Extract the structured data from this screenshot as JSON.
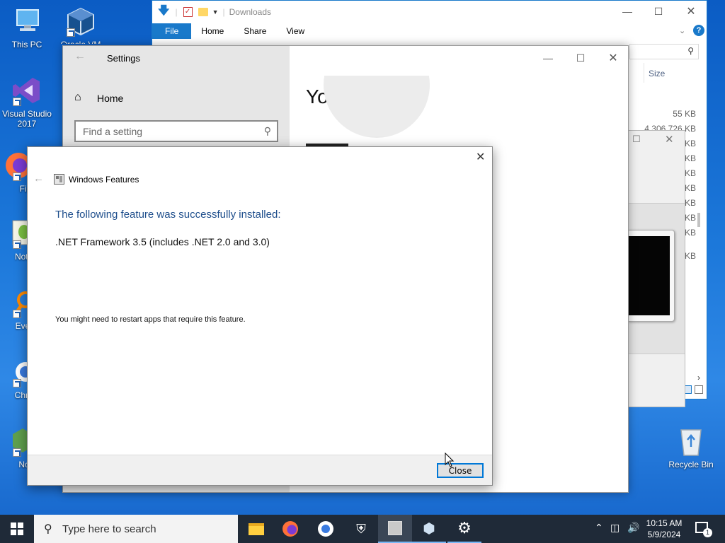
{
  "desktop": {
    "icons": [
      {
        "label": "This PC"
      },
      {
        "label": "Oracle VM"
      },
      {
        "label": "Visual Studio 2017"
      },
      {
        "label": "Fire"
      },
      {
        "label": "Notep"
      },
      {
        "label": "Every"
      },
      {
        "label": "Chron"
      },
      {
        "label": "Noc"
      },
      {
        "label": "Recycle Bin"
      }
    ]
  },
  "explorer": {
    "title": "Downloads",
    "ribbon_tabs": [
      "File",
      "Home",
      "Share",
      "View"
    ],
    "column_size": "Size",
    "sizes": [
      "55 KB",
      "4,306,726 KB",
      "KB",
      "KB",
      "KB",
      "KB",
      "KB",
      "KB",
      "KB",
      "KB"
    ]
  },
  "settings": {
    "title": "Settings",
    "home_label": "Home",
    "search_placeholder": "Find a setting",
    "heading": "Your info"
  },
  "features_dialog": {
    "title": "Windows Features",
    "success_text": "The following feature was successfully installed:",
    "feature_name": ".NET Framework 3.5 (includes .NET 2.0 and 3.0)",
    "note": "You might need to restart apps that require this feature.",
    "close_label": "Close"
  },
  "taskbar": {
    "search_placeholder": "Type here to search",
    "time": "10:15 AM",
    "date": "5/9/2024",
    "notification_count": "1"
  },
  "colors": {
    "accent": "#0078d7",
    "dialog_heading": "#1e4e8c",
    "taskbar": "#1f2a38"
  }
}
